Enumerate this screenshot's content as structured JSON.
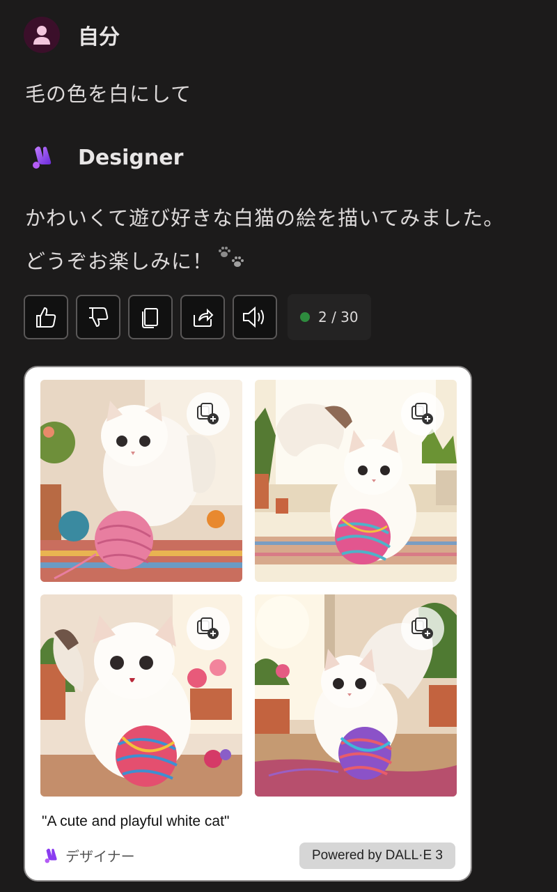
{
  "user": {
    "name": "自分",
    "message": "毛の色を白にして"
  },
  "bot": {
    "name": "Designer",
    "message": "かわいくて遊び好きな白猫の絵を描いてみました。どうぞお楽しみに！"
  },
  "actions": {
    "like": "thumbs-up-icon",
    "dislike": "thumbs-down-icon",
    "copy": "copy-icon",
    "share": "share-icon",
    "read_aloud": "speaker-icon",
    "counter": "2 / 30",
    "counter_color": "#2e8b3e"
  },
  "result_card": {
    "caption": "\"A cute and playful white cat\"",
    "brand_label": "デザイナー",
    "powered_by": "Powered by DALL·E 3",
    "images": [
      {
        "alt": "white cat with pink yarn"
      },
      {
        "alt": "white cat with rainbow yarn"
      },
      {
        "alt": "white cat with colorful yarn near window"
      },
      {
        "alt": "white cat with yarn in sunlight"
      }
    ]
  },
  "colors": {
    "background": "#1c1b1b",
    "avatar_bg": "#3b0f2a",
    "brand_purple": "#8a3cf0"
  }
}
